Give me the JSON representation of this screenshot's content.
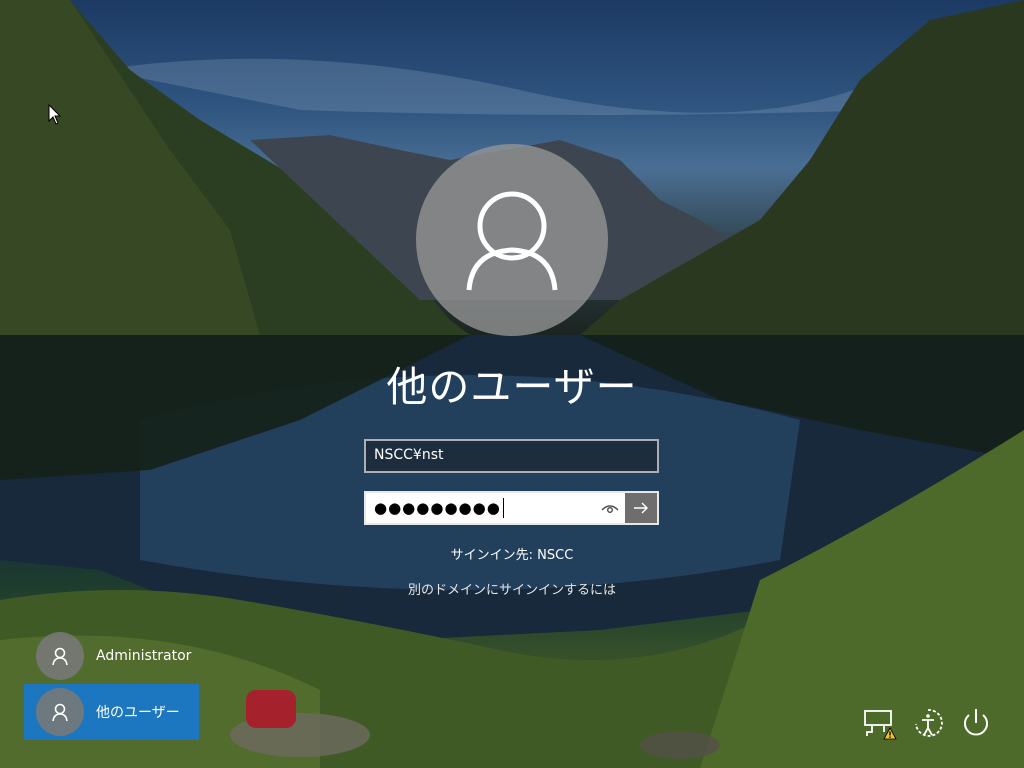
{
  "login": {
    "username_heading": "他のユーザー",
    "username_field_value": "NSCC¥nst",
    "password_mask": "●●●●●●●●●",
    "signin_to": "サインイン先: NSCC",
    "other_domain_link": "別のドメインにサインインするには"
  },
  "users": [
    {
      "label": "Administrator",
      "selected": false
    },
    {
      "label": "他のユーザー",
      "selected": true
    }
  ],
  "bottom_icons": [
    "network-warning-icon",
    "ease-of-access-icon",
    "power-icon"
  ],
  "colors": {
    "selected_tile": "#1c77c0",
    "avatar_bg": "#969696"
  }
}
